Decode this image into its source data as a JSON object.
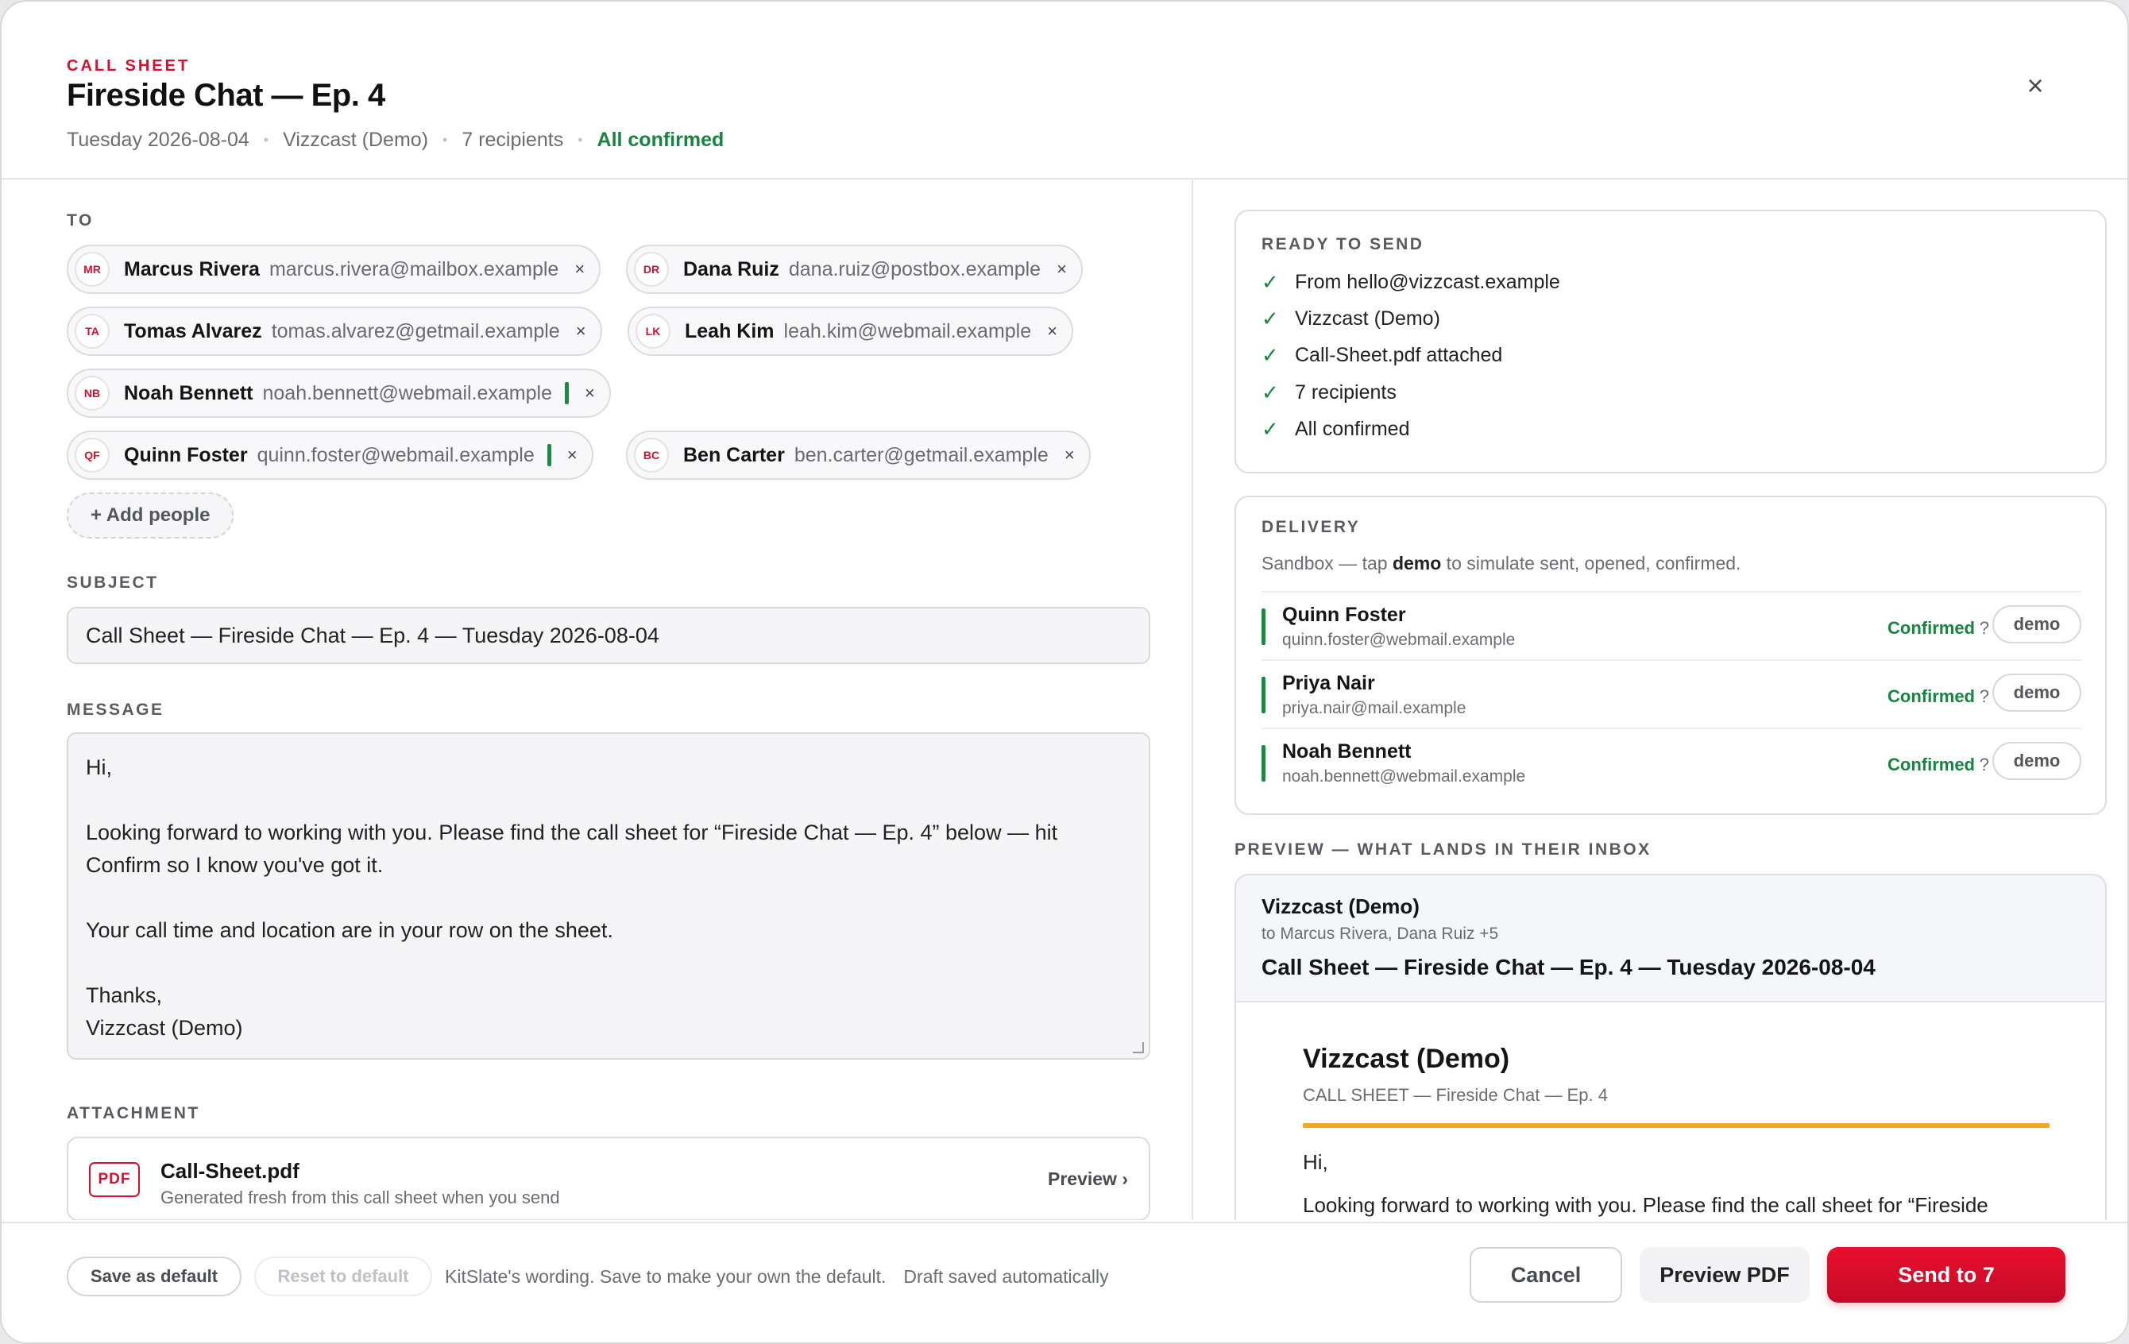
{
  "header": {
    "eyebrow": "CALL SHEET",
    "title": "Fireside Chat — Ep. 4",
    "date": "Tuesday 2026-08-04",
    "org": "Vizzcast (Demo)",
    "recipients": "7 recipients",
    "status": "All confirmed",
    "close_icon": "×",
    "status_color": "#17843f"
  },
  "to": {
    "label": "TO",
    "chips": [
      {
        "initials": "MR",
        "name": "Marcus Rivera",
        "email": "marcus.rivera@mailbox.example",
        "confirmed": false
      },
      {
        "initials": "DR",
        "name": "Dana Ruiz",
        "email": "dana.ruiz@postbox.example",
        "confirmed": false
      },
      {
        "initials": "TA",
        "name": "Tomas Alvarez",
        "email": "tomas.alvarez@getmail.example",
        "confirmed": false
      },
      {
        "initials": "LK",
        "name": "Leah Kim",
        "email": "leah.kim@webmail.example",
        "confirmed": false
      },
      {
        "initials": "NB",
        "name": "Noah Bennett",
        "email": "noah.bennett@webmail.example",
        "confirmed": true
      },
      {
        "initials": "QF",
        "name": "Quinn Foster",
        "email": "quinn.foster@webmail.example",
        "confirmed": true
      },
      {
        "initials": "BC",
        "name": "Ben Carter",
        "email": "ben.carter@getmail.example",
        "confirmed": false
      }
    ],
    "remove_icon": "×",
    "add_label": "+ Add people"
  },
  "subject": {
    "label": "SUBJECT",
    "value": "Call Sheet — Fireside Chat — Ep. 4 — Tuesday 2026-08-04"
  },
  "message": {
    "label": "MESSAGE",
    "value": "Hi,\n\nLooking forward to working with you. Please find the call sheet for “Fireside Chat — Ep. 4” below — hit\nConfirm so I know you've got it.\n\nYour call time and location are in your row on the sheet.\n\nThanks,\nVizzcast (Demo)"
  },
  "attachment": {
    "label": "ATTACHMENT",
    "badge": "PDF",
    "name": "Call-Sheet.pdf",
    "sub": "Generated fresh from this call sheet when you send",
    "preview": "Preview ›"
  },
  "ready": {
    "label": "READY TO SEND",
    "check_icon": "✓",
    "items": [
      "From hello@vizzcast.example",
      "Vizzcast (Demo)",
      "Call-Sheet.pdf attached",
      "7 recipients",
      "All confirmed"
    ]
  },
  "delivery": {
    "label": "DELIVERY",
    "sub_prefix": "Sandbox — tap ",
    "sub_bold": "demo",
    "sub_suffix": " to simulate sent, opened, confirmed.",
    "rows": [
      {
        "name": "Quinn Foster",
        "email": "quinn.foster@webmail.example",
        "status": "Confirmed",
        "help": "?",
        "action": "demo"
      },
      {
        "name": "Priya Nair",
        "email": "priya.nair@mail.example",
        "status": "Confirmed",
        "help": "?",
        "action": "demo"
      },
      {
        "name": "Noah Bennett",
        "email": "noah.bennett@webmail.example",
        "status": "Confirmed",
        "help": "?",
        "action": "demo"
      }
    ]
  },
  "preview": {
    "label": "PREVIEW — WHAT LANDS IN THEIR INBOX",
    "from": "Vizzcast (Demo)",
    "to": "to Marcus Rivera, Dana Ruiz +5",
    "subject": "Call Sheet — Fireside Chat — Ep. 4 — Tuesday 2026-08-04",
    "brand": "Vizzcast (Demo)",
    "kicker": "CALL SHEET — Fireside Chat — Ep. 4",
    "hi": "Hi,",
    "body": "Looking forward to working with you. Please find the call sheet for “Fireside",
    "accent_color": "#f0a820"
  },
  "footer": {
    "save_default": "Save as default",
    "reset_default": "Reset to default",
    "note1": "KitSlate's wording. Save to make your own the default.",
    "note2": "Draft saved automatically",
    "cancel": "Cancel",
    "preview_pdf": "Preview PDF",
    "send": "Send to 7",
    "brand_color": "#d8102e"
  }
}
